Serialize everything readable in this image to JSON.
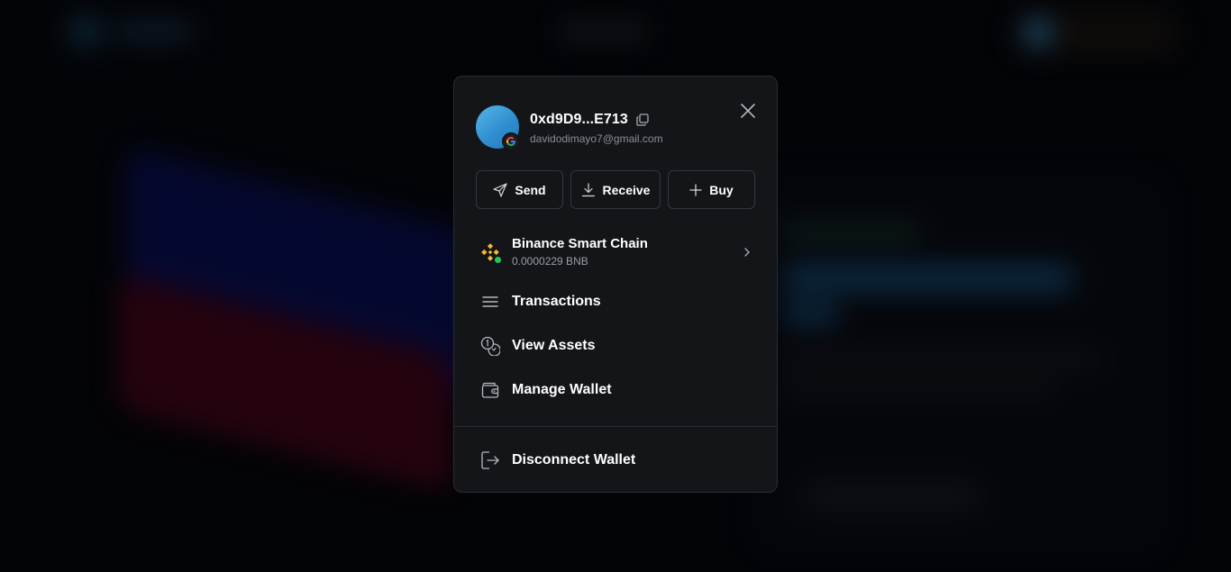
{
  "colors": {
    "modal_background": "#141518",
    "border": "#2a2c31",
    "text_primary": "#ffffff",
    "text_secondary": "#8a8d94",
    "bnb_yellow": "#f3ba2f",
    "status_green": "#22c55e",
    "avatar_blue": "#3a9ad8"
  },
  "wallet": {
    "address": "0xd9D9...E713",
    "email": "davidodimayo7@gmail.com",
    "login_provider_icon": "google-icon",
    "copy_icon": "copy-icon",
    "close_icon": "close-icon"
  },
  "actions": [
    {
      "label": "Send",
      "icon": "send-icon"
    },
    {
      "label": "Receive",
      "icon": "download-icon"
    },
    {
      "label": "Buy",
      "icon": "plus-icon"
    }
  ],
  "network": {
    "name": "Binance Smart Chain",
    "balance": "0.0000229 BNB",
    "icon": "bnb-icon",
    "status": "connected"
  },
  "menu": [
    {
      "label": "Transactions",
      "icon": "list-icon"
    },
    {
      "label": "View Assets",
      "icon": "coins-icon"
    },
    {
      "label": "Manage Wallet",
      "icon": "wallet-icon"
    }
  ],
  "disconnect": {
    "label": "Disconnect Wallet",
    "icon": "logout-icon"
  }
}
